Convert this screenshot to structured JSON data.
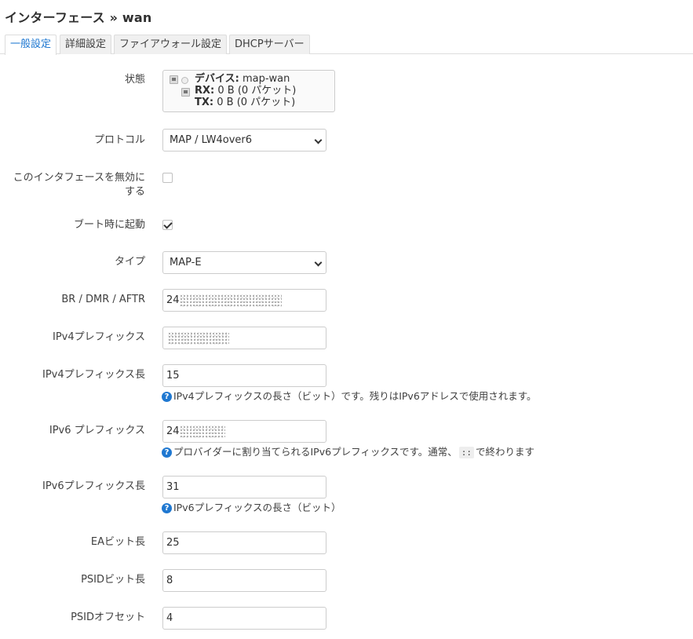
{
  "page": {
    "title": "インターフェース » wan"
  },
  "tabs": [
    {
      "label": "一般設定",
      "active": true
    },
    {
      "label": "詳細設定",
      "active": false
    },
    {
      "label": "ファイアウォール設定",
      "active": false
    },
    {
      "label": "DHCPサーバー",
      "active": false
    }
  ],
  "status": {
    "label": "状態",
    "device_key": "デバイス:",
    "device_value": "map-wan",
    "rx_key": "RX:",
    "rx_value": "0 B (0 パケット)",
    "tx_key": "TX:",
    "tx_value": "0 B (0 パケット)"
  },
  "protocol": {
    "label": "プロトコル",
    "value": "MAP / LW4over6"
  },
  "disable": {
    "label": "このインタフェースを無効にする",
    "checked": false
  },
  "boot": {
    "label": "ブート時に起動",
    "checked": true
  },
  "type": {
    "label": "タイプ",
    "value": "MAP-E"
  },
  "br": {
    "label": "BR / DMR / AFTR",
    "value_visible": "24"
  },
  "ipv4_prefix": {
    "label": "IPv4プレフィックス",
    "value_visible": ""
  },
  "ipv4_prefix_len": {
    "label": "IPv4プレフィックス長",
    "value": "15",
    "help": "IPv4プレフィックスの長さ（ビット）です。残りはIPv6アドレスで使用されます。"
  },
  "ipv6_prefix": {
    "label": "IPv6 プレフィックス",
    "value_visible": "24",
    "help_before": "プロバイダーに割り当てられるIPv6プレフィックスです。通常、",
    "help_code": "::",
    "help_after": "で終わります"
  },
  "ipv6_prefix_len": {
    "label": "IPv6プレフィックス長",
    "value": "31",
    "help": "IPv6プレフィックスの長さ（ビット）"
  },
  "ea_len": {
    "label": "EAビット長",
    "value": "25"
  },
  "psid_len": {
    "label": "PSIDビット長",
    "value": "8"
  },
  "psid_offset": {
    "label": "PSIDオフセット",
    "value": "4"
  },
  "colors": {
    "accent": "#1f78d1",
    "help_icon": "#1f78d1"
  },
  "icons": {
    "help": "?"
  }
}
